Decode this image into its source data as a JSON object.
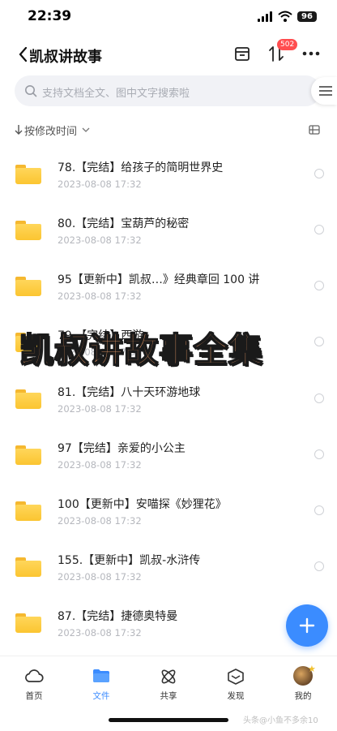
{
  "status": {
    "time": "22:39",
    "battery": "96"
  },
  "header": {
    "title": "凯叔讲故事",
    "badge": "502"
  },
  "search": {
    "placeholder": "支持文档全文、图中文字搜索啦"
  },
  "sort": {
    "label": "按修改时间"
  },
  "files": [
    {
      "name": "78.【完结】给孩子的简明世界史",
      "date": "2023-08-08 17:32"
    },
    {
      "name": "80.【完结】宝葫芦的秘密",
      "date": "2023-08-08 17:32"
    },
    {
      "name": "95【更新中】凯叔…》经典章回 100 讲",
      "date": "2023-08-08 17:32"
    },
    {
      "name": "79.【完结】西游",
      "date": "2023-08-08 17:32"
    },
    {
      "name": "81.【完结】八十天环游地球",
      "date": "2023-08-08 17:32"
    },
    {
      "name": "97【完结】亲爱的小公主",
      "date": "2023-08-08 17:32"
    },
    {
      "name": "100【更新中】安喵探《妙狸花》",
      "date": "2023-08-08 17:32"
    },
    {
      "name": "155.【更新中】凯叔-水浒传",
      "date": "2023-08-08 17:32"
    },
    {
      "name": "87.【完结】捷德奥特曼",
      "date": "2023-08-08 17:32"
    }
  ],
  "overlay": {
    "text": "凯叔讲故事全集"
  },
  "nav": [
    {
      "label": "首页",
      "icon": "cloud-icon"
    },
    {
      "label": "文件",
      "icon": "folder-icon",
      "active": true
    },
    {
      "label": "共享",
      "icon": "share-atom-icon"
    },
    {
      "label": "发现",
      "icon": "discover-cube-icon"
    },
    {
      "label": "我的",
      "icon": "avatar-icon"
    }
  ],
  "colors": {
    "accent": "#3b8cff",
    "folder": "#fbc531",
    "badge": "#ff4d4f",
    "overlay_text": "#f7a26b"
  },
  "watermark": "头条@小鱼不多余10"
}
